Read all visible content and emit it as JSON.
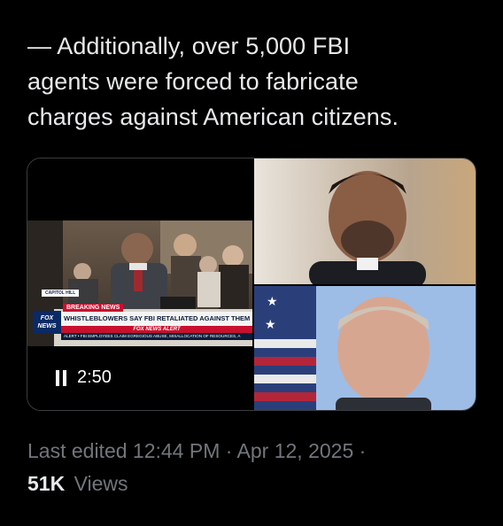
{
  "tweet": {
    "text_line1": "— Additionally, over 5,000 FBI",
    "text_line2": "agents were forced to fabricate",
    "text_line3": "charges against American citizens."
  },
  "media": {
    "video": {
      "duration": "2:50",
      "state_icon": "pause-icon",
      "news_overlay": {
        "location_tag": "CAPITOL HILL",
        "breaking_label": "BREAKING NEWS",
        "headline": "WHISTLEBLOWERS SAY FBI RETALIATED AGAINST THEM",
        "alert_label": "FOX NEWS ALERT",
        "ticker": "ALERT • FBI EMPLOYEES CLAIM EGREGIOUS ABUSE, MISALLOCATION OF RESOURCES, A",
        "logo_text": "FOX NEWS"
      }
    }
  },
  "meta": {
    "last_edited": "Last edited 12:44 PM · Apr 12, 2025 ·",
    "views_count": "51K",
    "views_label": "Views"
  },
  "colors": {
    "background": "#000000",
    "text_primary": "#e7e9ea",
    "text_secondary": "#71767b",
    "media_border": "#3a3d40"
  }
}
